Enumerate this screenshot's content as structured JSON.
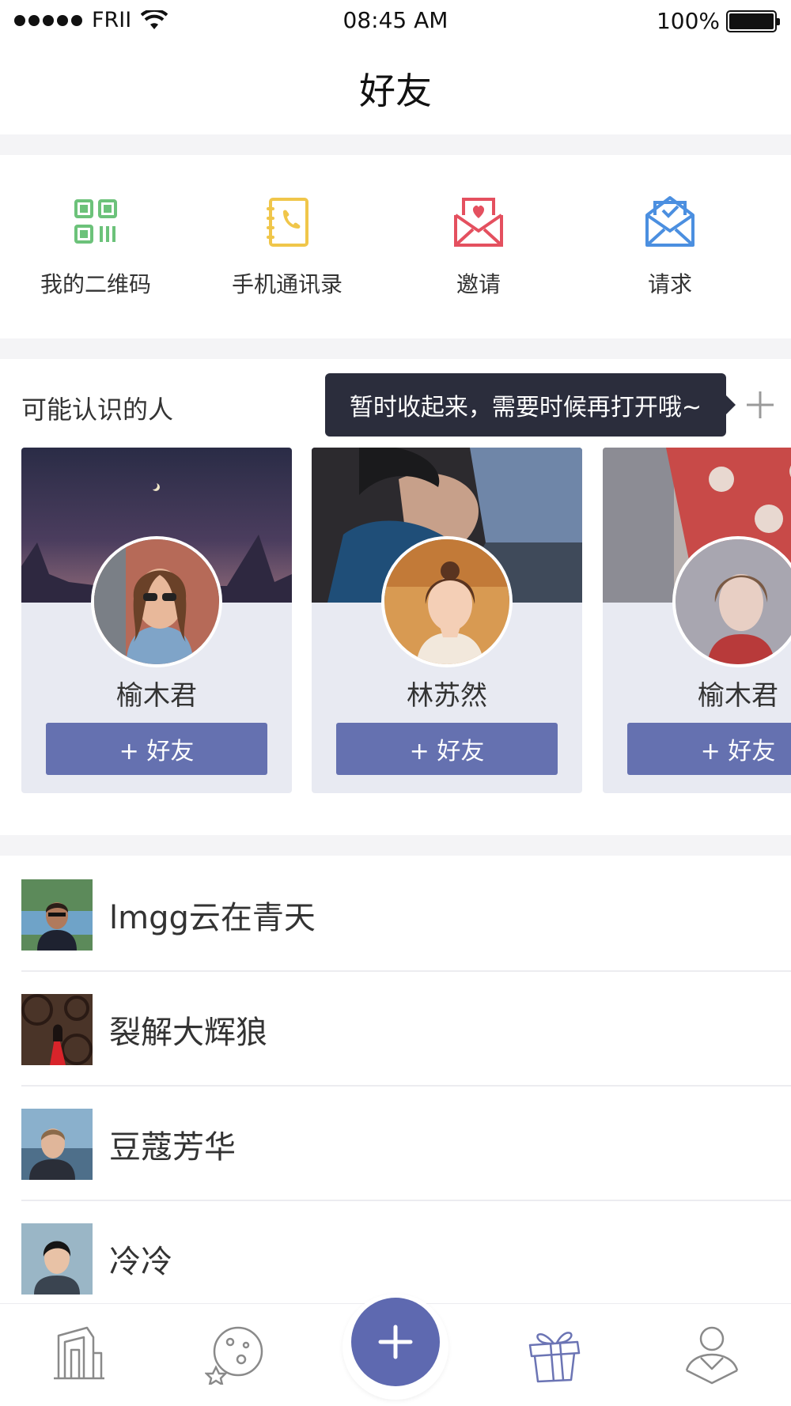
{
  "status_bar": {
    "carrier": "FRII",
    "time": "08:45 AM",
    "battery": "100%"
  },
  "header": {
    "title": "好友"
  },
  "quick_actions": [
    {
      "label": "我的二维码",
      "icon": "qr-code-icon",
      "color": "#6cc27a"
    },
    {
      "label": "手机通讯录",
      "icon": "phone-book-icon",
      "color": "#f0c64a"
    },
    {
      "label": "邀请",
      "icon": "invite-envelope-icon",
      "color": "#e4505f"
    },
    {
      "label": "请求",
      "icon": "request-envelope-icon",
      "color": "#4b8fe0"
    }
  ],
  "people": {
    "title": "可能认识的人",
    "tooltip": "暂时收起来，需要时候再打开哦~",
    "cards": [
      {
        "name": "榆木君",
        "button": "+ 好友"
      },
      {
        "name": "林苏然",
        "button": "+ 好友"
      },
      {
        "name": "榆木君",
        "button": "+ 好友"
      }
    ]
  },
  "friends": [
    {
      "name": "lmgg云在青天"
    },
    {
      "name": "裂解大辉狼"
    },
    {
      "name": "豆蔻芳华"
    },
    {
      "name": "冷冷"
    }
  ],
  "tabbar": {
    "tabs": [
      "building-icon",
      "planet-icon",
      "add-icon",
      "gift-icon",
      "profile-icon"
    ],
    "accent": "#5e69b0"
  }
}
